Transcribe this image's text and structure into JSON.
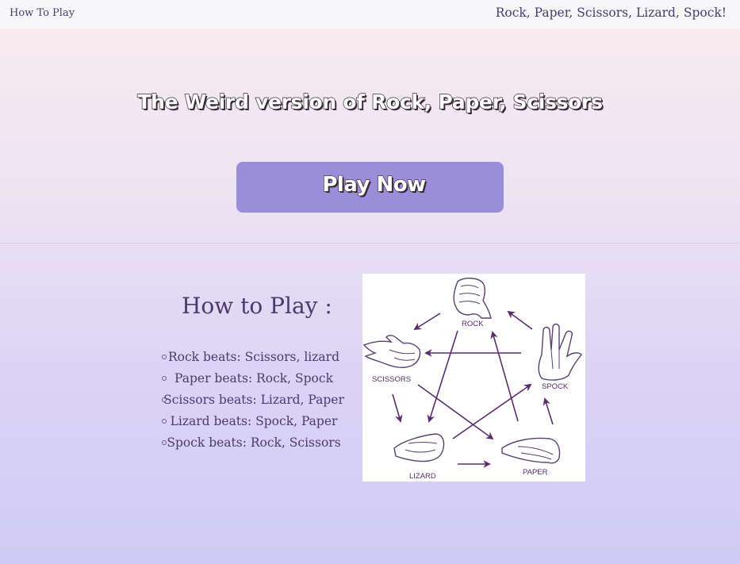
{
  "nav": {
    "how_to_play_link": "How To Play",
    "brand": "Rock, Paper, Scissors, Lizard, Spock!"
  },
  "hero": {
    "title": "The Weird version of Rock, Paper, Scissors",
    "play_button": "Play Now"
  },
  "how_to_play": {
    "heading": "How to Play :",
    "rules": [
      "Rock beats: Scissors, lizard",
      "Paper beats: Rock, Spock",
      "Scissors beats: Lizard, Paper",
      "Lizard beats: Spock, Paper",
      "Spock beats: Rock, Scissors"
    ]
  },
  "diagram": {
    "labels": {
      "rock": "ROCK",
      "spock": "SPOCK",
      "paper": "PAPER",
      "lizard": "LIZARD",
      "scissors": "SCISSORS"
    }
  },
  "colors": {
    "text": "#4a3a6e",
    "button": "#9b8ed9",
    "arrows": "#5a2d6e",
    "topbar": "#f7f7fa"
  }
}
